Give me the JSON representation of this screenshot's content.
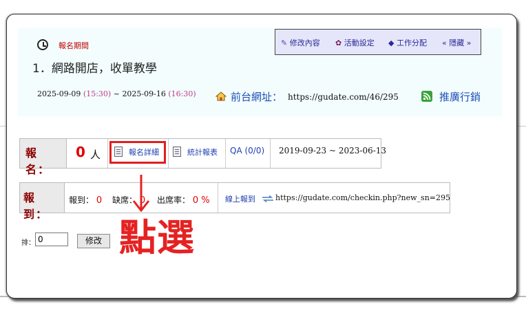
{
  "header": {
    "period_label": "報名期間",
    "event_title": "1．網路開店，收單教學",
    "start_date": "2025-09-09",
    "start_time": "(15:30)",
    "sep": " ~ ",
    "end_date": "2025-09-16",
    "end_time": "(16:30)",
    "front_label": "前台網址：",
    "front_url": "https://gudate.com/46/295",
    "promo_label": "推廣行銷"
  },
  "toolbar": {
    "edit": "修改內容",
    "settings": "活動設定",
    "assign": "工作分配",
    "hide": "« 隱藏 »",
    "edit_icon": "pencil-icon",
    "settings_icon": "gear-icon",
    "assign_icon": "tag-icon"
  },
  "registration": {
    "head": "報 名：",
    "count": "0",
    "unit": "人",
    "detail": "報名詳細",
    "stats": "統計報表",
    "qa": "QA (0/0)",
    "range": "2019-09-23 ~ 2023-06-13"
  },
  "checkin": {
    "head": "報 到：",
    "checked_label": "報到：",
    "checked_value": "0",
    "absent_label": "缺席：",
    "absent_value": "0",
    "rate_label": "出席率：",
    "rate_value": "0 %",
    "online_label": "線上報到",
    "url": "https://gudate.com/checkin.php?new_sn=295"
  },
  "sort": {
    "label": "排：",
    "value": "0",
    "button": "修改"
  },
  "annotation": {
    "text": "點選"
  },
  "colors": {
    "accent_red": "#e01e1e",
    "link_blue": "#1f4fb8",
    "toolbar_bg": "#e6e6fa",
    "panel_bg": "#f3fdfd"
  }
}
